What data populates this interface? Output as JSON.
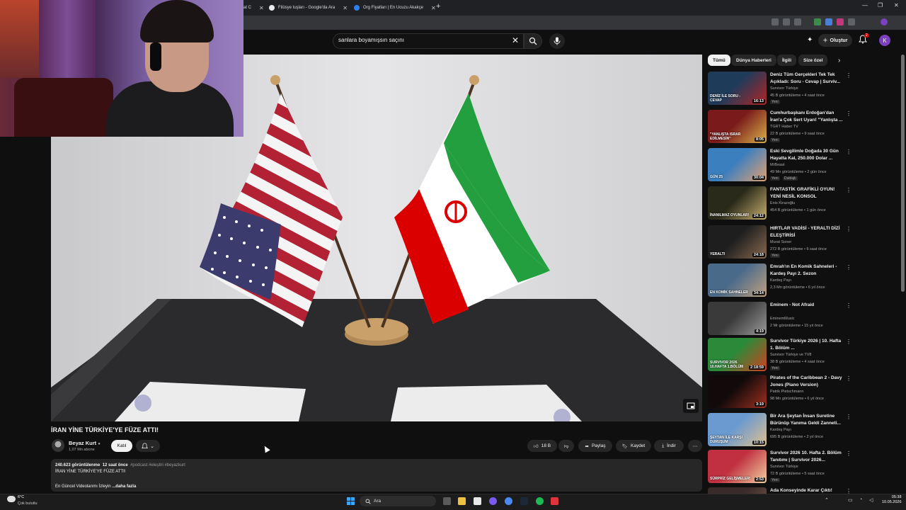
{
  "browser": {
    "tabs": [
      {
        "title": "at C"
      },
      {
        "title": "Filüsye tuşları - Google'da Ara"
      },
      {
        "title": "Org Fiyatları | En Ucuzu Akakçe"
      }
    ],
    "new_tab": "+",
    "window_controls": [
      "—",
      "❐",
      "✕"
    ]
  },
  "masthead": {
    "search_value": "sanlara boyamışsın saçını",
    "create_label": "Oluştur",
    "notification_count": "2",
    "user_initial": "K"
  },
  "video": {
    "title": "İRAN YİNE TÜRKİYE'YE FÜZE ATTI!",
    "channel_name": "Beyaz Kurt",
    "subscribers": "1,07 Mn abone",
    "join_label": "Katıl",
    "likes": "18 B",
    "share_label": "Paylaş",
    "save_label": "Kaydet",
    "download_label": "İndir",
    "views": "240.623 görüntülenme",
    "time_ago": "12 saat önce",
    "hashtags": "#podcast #eleştiri #beyazkurt",
    "desc_line1": "İRAN YİNE TÜRKİYE'YE FÜZE ATTI!",
    "desc_line2": "En Güncel Videolarımı İzleyin",
    "more_label": "...daha fazla"
  },
  "chips": [
    "Tümü",
    "Dünya Haberleri",
    "İlgili",
    "Size özel"
  ],
  "recommendations": [
    {
      "title": "Deniz Tüm Gerçekleri Tek Tek Açıkladı: Soru - Cevap | Surviv...",
      "channel": "Survivor Türkiye",
      "meta": "45 B görüntüleme • 4 saat önce",
      "badge": "Yeni",
      "duration": "16:13",
      "colors": [
        "#1f3b5a",
        "#b32424"
      ]
    },
    {
      "title": "Cumhurbaşkanı Erdoğan'dan İran'a Çok Sert Uyarı! \"Yanlışta ...",
      "channel": "TGRT Haber TV",
      "meta": "22 B görüntüleme • 9 saat önce",
      "badge": "Yeni",
      "duration": "8:05",
      "colors": [
        "#7a1a1a",
        "#d9b24a"
      ]
    },
    {
      "title": "Eski Sevgilimle Doğada 30 Gün Hayatta Kal, 250.000 Dolar ...",
      "channel": "MrBeast",
      "meta": "49 Mn görüntüleme • 2 gün önce",
      "badge": "Yeni",
      "badge2": "Dublajlı",
      "duration": "30:04",
      "colors": [
        "#3b7fbf",
        "#e0a070"
      ]
    },
    {
      "title": "FANTASTİK GRAFİKLİ OYUN! YENİ NESİL KONSOL GELİYOR!...",
      "channel": "Enis Kirazoğlu",
      "meta": "454 B görüntüleme • 1 gün önce",
      "badge": "",
      "duration": "24:12",
      "colors": [
        "#2a2a1a",
        "#c8b070"
      ]
    },
    {
      "title": "HIRTLAR VADİSİ - YERALTI DİZİ ELEŞTİRİSİ",
      "channel": "Murat Soner",
      "meta": "272 B görüntüleme • 6 saat önce",
      "badge": "Yeni",
      "duration": "24:18",
      "colors": [
        "#1e1e1e",
        "#8a6a50"
      ]
    },
    {
      "title": "Emrah'ın En Komik Sahneleri - Kardeş Payı 2. Sezon",
      "channel": "Kardeş Payı",
      "meta": "2,3 Mn görüntüleme • 6 yıl önce",
      "badge": "",
      "duration": "34:14",
      "colors": [
        "#4a6a8a",
        "#c0a080"
      ]
    },
    {
      "title": "Eminem - Not Afraid",
      "channel": "EminemMusic",
      "meta": "2 Mr görüntüleme • 15 yıl önce",
      "badge": "",
      "duration": "4:19",
      "colors": [
        "#3a3a3a",
        "#9a9a9a"
      ]
    },
    {
      "title": "Survivor Türkiye 2026 | 10. Hafta 1. Bölüm ...",
      "channel": "Survivor Türkiye ve TV8",
      "meta": "38 B görüntüleme • 4 saat önce",
      "badge": "Yeni",
      "duration": "2:18:59",
      "colors": [
        "#2a8a3a",
        "#d04020"
      ]
    },
    {
      "title": "Pirates of the Caribbean 2 - Davy Jones (Piano Version)",
      "channel": "Patrik Pietschmann",
      "meta": "98 Mn görüntüleme • 6 yıl önce",
      "badge": "",
      "duration": "3:19",
      "colors": [
        "#120a0a",
        "#a03020"
      ]
    },
    {
      "title": "Bir Ara Şeytan İnsan Suretine Bürünüp Yanıma Geldi Zanneti...",
      "channel": "Kardeş Payı",
      "meta": "695 B görüntüleme • 2 yıl önce",
      "badge": "",
      "duration": "10:15",
      "colors": [
        "#6a9acf",
        "#e0c090"
      ]
    },
    {
      "title": "Survivor 2026 10. Hafta 2. Bölüm Tanıtımı | Survivor 2026...",
      "channel": "Survivor Türkiye",
      "meta": "72 B görüntüleme • 5 saat önce",
      "badge": "Yeni",
      "duration": "2:53",
      "colors": [
        "#c03040",
        "#f0d0a0"
      ]
    },
    {
      "title": "Ada Konseyinde Karar Çıktı!",
      "channel": "",
      "meta": "",
      "badge": "",
      "duration": "",
      "colors": [
        "#3a2a2a",
        "#806050"
      ]
    }
  ],
  "thumb_texts": {
    "r0": "DENİZ İLE SORU - CEVAP",
    "r1": "\"YANLIŞTA ISRAR EDİLMESİN\"",
    "r2": "GÜN 25",
    "r3": "İNANILMAZ OYUNLAR!",
    "r4": "YERALTI",
    "r5": "EN KOMİK SAHNELER",
    "r7": "SURVIVOR 2026 10.HAFTA 1.BÖLÜM",
    "r9": "ŞEYTAN İLE KARŞI DURUŞUM",
    "r10": "SÜRPRİZ GELİŞMELER!"
  },
  "taskbar": {
    "weather_temp": "6°C",
    "weather_desc": "Çok bulutlu",
    "search_label": "Ara",
    "time": "05:38",
    "date": "10.05.2026"
  },
  "colors": {
    "background": "#0f0f0f",
    "chip_bg": "#272727",
    "text": "#f1f1f1",
    "meta": "#aaaaaa",
    "iran_green": "#239f40",
    "iran_red": "#da0000",
    "us_red": "#b22234",
    "us_blue": "#3c3b6e"
  }
}
